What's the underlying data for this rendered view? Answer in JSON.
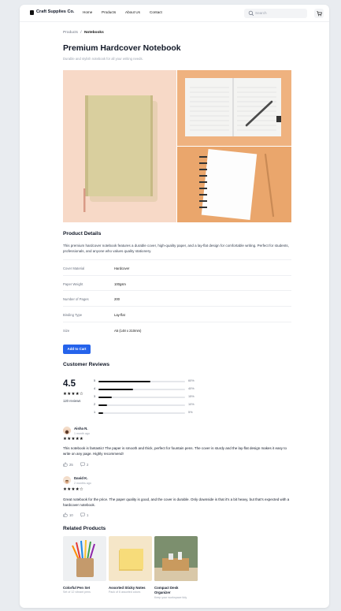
{
  "header": {
    "brand": "Craft Supplies Co.",
    "nav": [
      "Home",
      "Products",
      "About Us",
      "Contact"
    ],
    "search_placeholder": "Search"
  },
  "breadcrumb": {
    "parent": "Products",
    "sep": "/",
    "current": "Notebooks"
  },
  "product": {
    "title": "Premium Hardcover Notebook",
    "tagline": "Durable and stylish notebook for all your writing needs."
  },
  "details": {
    "heading": "Product Details",
    "description": "This premium hardcover notebook features a durable cover, high-quality paper, and a lay-flat design for comfortable writing. Perfect for students, professionals, and anyone who values quality stationery.",
    "specs": [
      {
        "key": "Cover Material",
        "value": "Hardcover"
      },
      {
        "key": "Paper Weight",
        "value": "100gsm"
      },
      {
        "key": "Number of Pages",
        "value": "200"
      },
      {
        "key": "Binding Type",
        "value": "Lay-flat"
      },
      {
        "key": "Size",
        "value": "A5 (148 x 210mm)"
      }
    ]
  },
  "cart_button": "Add to Cart",
  "reviews": {
    "heading": "Customer Reviews",
    "average": "4.5",
    "average_stars": "★★★★☆",
    "count_label": "120 reviews",
    "distribution": [
      {
        "stars": "5",
        "percent": 60,
        "label": "60%"
      },
      {
        "stars": "4",
        "percent": 40,
        "label": "40%"
      },
      {
        "stars": "3",
        "percent": 15,
        "label": "15%"
      },
      {
        "stars": "2",
        "percent": 10,
        "label": "10%"
      },
      {
        "stars": "1",
        "percent": 5,
        "label": "5%"
      }
    ],
    "items": [
      {
        "name": "Aisha N.",
        "date": "1 month ago",
        "stars": "★★★★★",
        "text": "This notebook is fantastic! The paper is smooth and thick, perfect for fountain pens. The cover is sturdy and the lay-flat design makes it easy to write on any page. Highly recommend!",
        "likes": "25",
        "comments": "2"
      },
      {
        "name": "David K.",
        "date": "2 months ago",
        "stars": "★★★★☆",
        "text": "Great notebook for the price. The paper quality is good, and the cover is durable. Only downside is that it's a bit heavy, but that's expected with a hardcover notebook.",
        "likes": "10",
        "comments": "1"
      }
    ]
  },
  "related": {
    "heading": "Related Products",
    "items": [
      {
        "title": "Colorful Pen Set",
        "subtitle": "Set of 12 vibrant pens"
      },
      {
        "title": "Assorted Sticky Notes",
        "subtitle": "Pack of 6 assorted colors"
      },
      {
        "title": "Compact Desk Organizer",
        "subtitle": "Keep your workspace tidy"
      }
    ]
  }
}
